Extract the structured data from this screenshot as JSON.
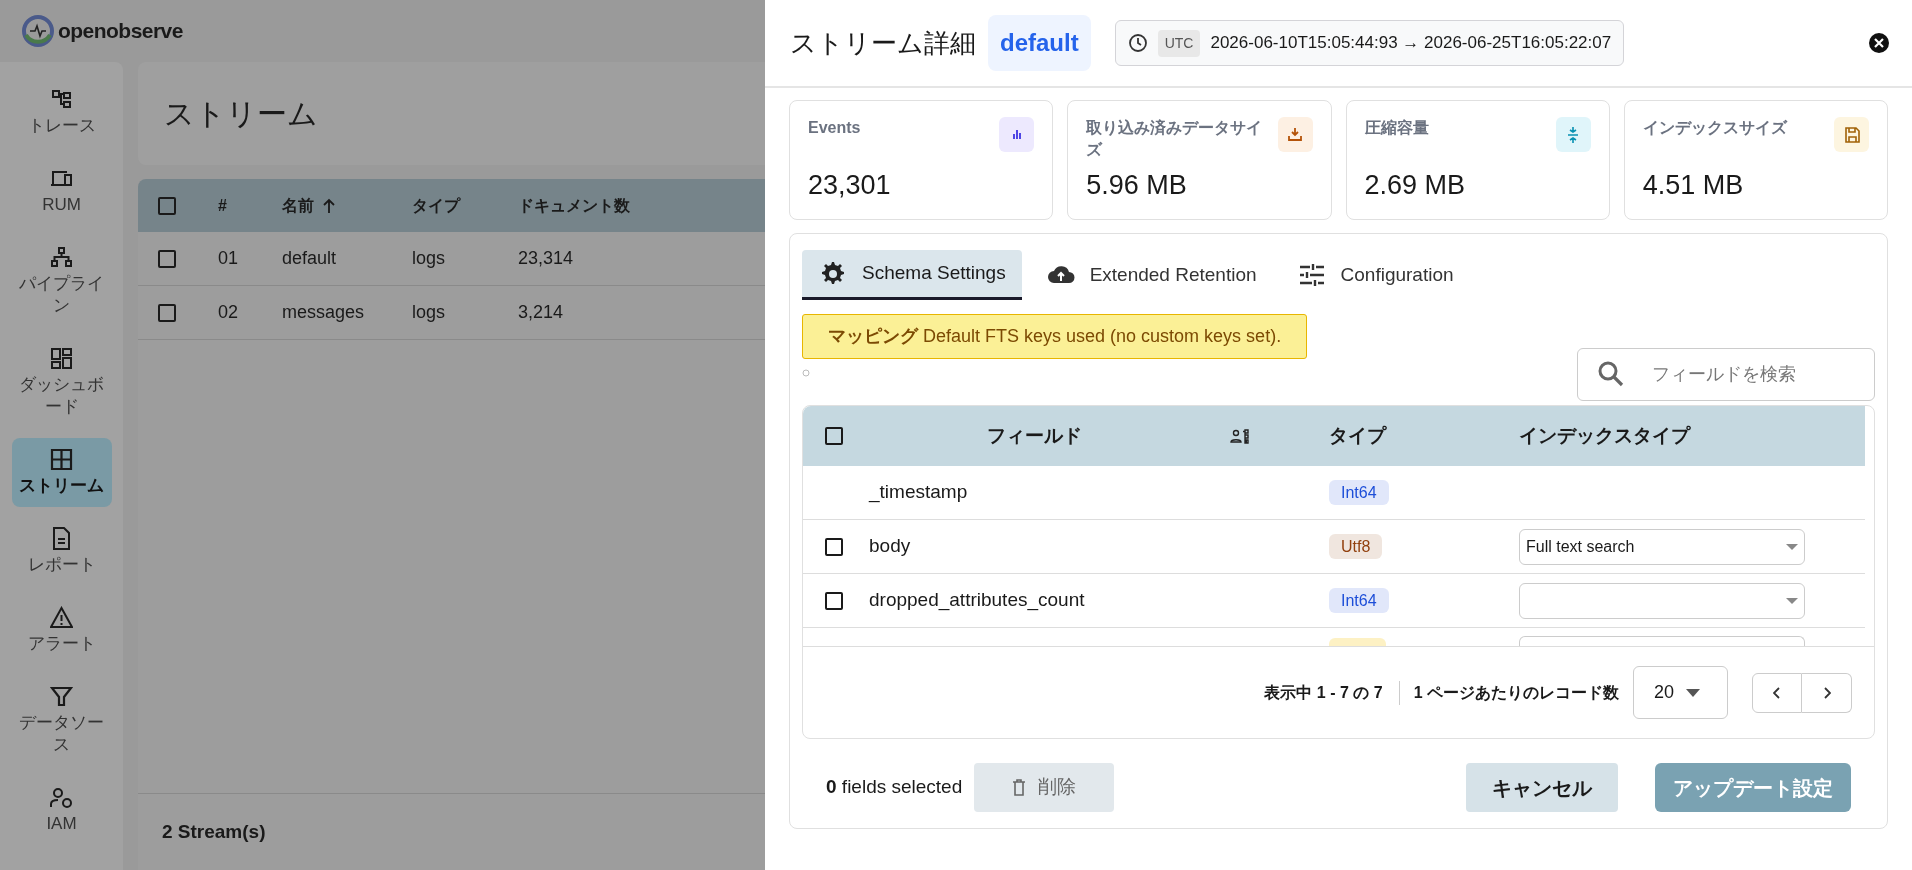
{
  "app": {
    "brand": "openobserve"
  },
  "sidebar": {
    "items": [
      {
        "label": "トレース",
        "selected": false
      },
      {
        "label": "RUM",
        "selected": false
      },
      {
        "label": "パイプライン",
        "selected": false
      },
      {
        "label": "ダッシュボード",
        "selected": false
      },
      {
        "label": "ストリーム",
        "selected": true
      },
      {
        "label": "レポート",
        "selected": false
      },
      {
        "label": "アラート",
        "selected": false
      },
      {
        "label": "データソース",
        "selected": false
      },
      {
        "label": "IAM",
        "selected": false
      }
    ]
  },
  "page": {
    "title": "ストリーム",
    "table": {
      "all_checked": false,
      "columns": [
        {
          "label": "#",
          "sorted": false
        },
        {
          "label": "名前",
          "sorted": true
        },
        {
          "label": "タイプ",
          "sorted": false
        },
        {
          "label": "ドキュメント数",
          "sorted": false
        }
      ],
      "rows": [
        {
          "checked": false,
          "cells": [
            "01",
            "default",
            "logs",
            "23,314"
          ]
        },
        {
          "checked": false,
          "cells": [
            "02",
            "messages",
            "logs",
            "3,214"
          ]
        }
      ]
    },
    "footer": "2 Stream(s)"
  },
  "drawer": {
    "title": "ストリーム詳細",
    "stream": "default",
    "timezone": "UTC",
    "range": "2026-06-10T15:05:44:93 → 2026-06-25T16:05:22:07",
    "stats": [
      {
        "label": "Events",
        "value": "23,301"
      },
      {
        "label": "取り込み済みデータサイズ",
        "value": "5.96 MB"
      },
      {
        "label": "圧縮容量",
        "value": "2.69 MB"
      },
      {
        "label": "インデックスサイズ",
        "value": "4.51 MB"
      }
    ],
    "tabs": [
      {
        "label": "Schema Settings",
        "selected": true
      },
      {
        "label": "Extended Retention",
        "selected": false
      },
      {
        "label": "Configuration",
        "selected": false
      }
    ],
    "banner": "**マッピング** Default FTS keys used (no custom keys set).",
    "search": {
      "placeholder": "フィールドを検索"
    },
    "fields_table": {
      "all_checked": false,
      "columns": [
        "フィールド",
        "タイプ",
        "インデックスタイプ"
      ],
      "rows": [
        {
          "kind": "locked",
          "name": "_timestamp",
          "type": "Int64",
          "color": "#1d4ed8"
        },
        {
          "kind": "editable",
          "checked": false,
          "name": "body",
          "type": "Utf8",
          "color": "#92400e",
          "index_type": "Full text search"
        },
        {
          "kind": "editable",
          "checked": false,
          "name": "dropped_attributes_count",
          "type": "Int64",
          "color": "#1d4ed8"
        },
        {
          "kind": "clipped"
        }
      ]
    },
    "pagination": {
      "showing": "表示中 1 - 7 の 7",
      "per_page_label": "1 ページあたりのレコード数",
      "per_page": "20"
    },
    "selection": "**0** fields selected",
    "delete_button": "削除",
    "cancel_button": "キャンセル",
    "update_button": "アップデート設定"
  }
}
